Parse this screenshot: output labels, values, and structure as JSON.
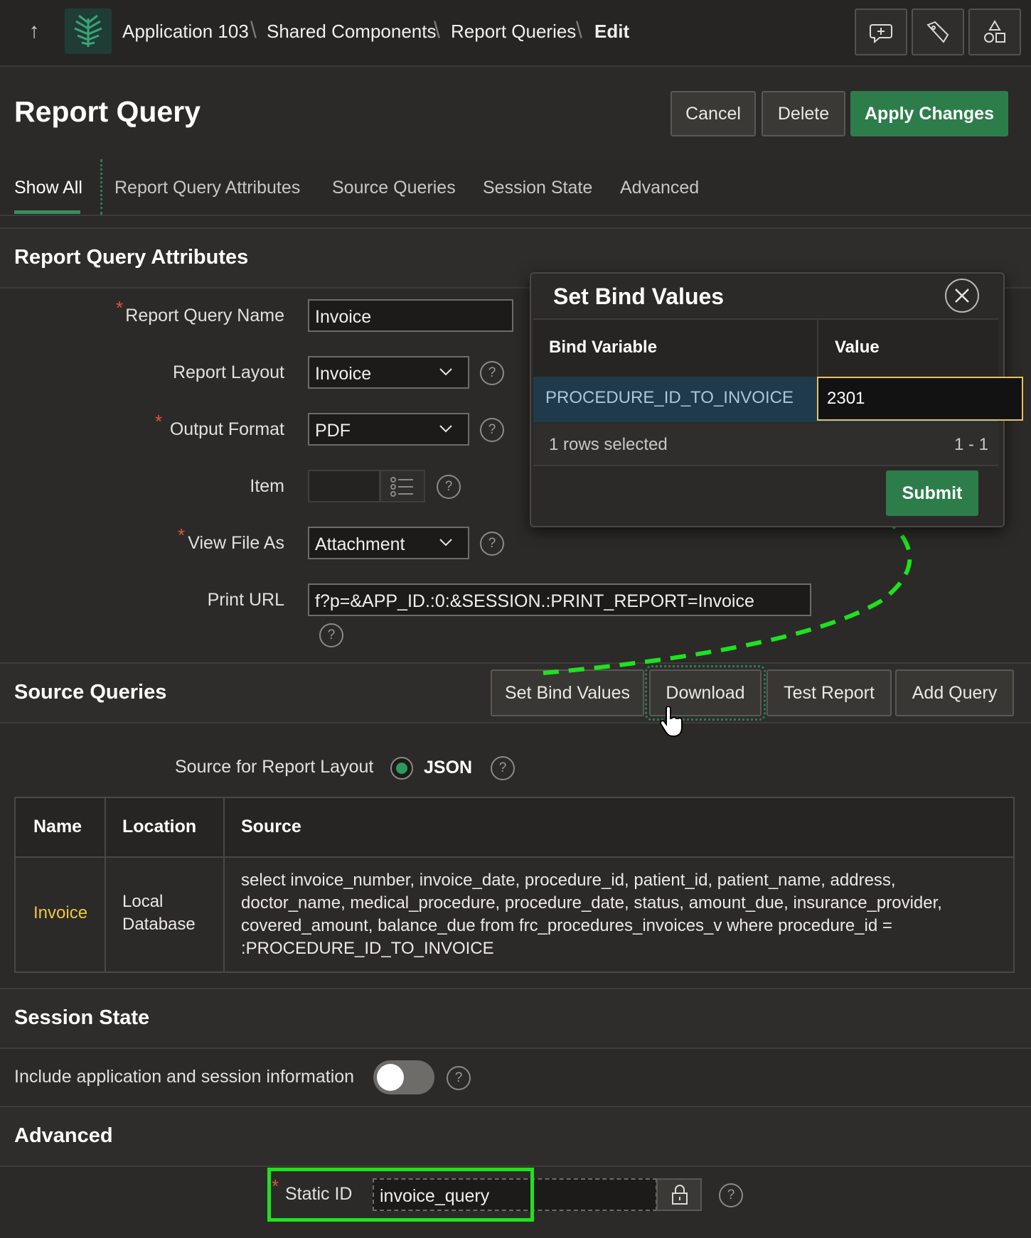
{
  "breadcrumbs": [
    "Application 103",
    "Shared Components",
    "Report Queries",
    "Edit"
  ],
  "toolbar_icons": [
    "feedback-icon",
    "developer-tools-icon",
    "shared-components-icon"
  ],
  "page_title": "Report Query",
  "header_buttons": {
    "cancel": "Cancel",
    "delete": "Delete",
    "apply": "Apply Changes"
  },
  "tabs": [
    "Show All",
    "Report Query Attributes",
    "Source Queries",
    "Session State",
    "Advanced"
  ],
  "attributes": {
    "title": "Report Query Attributes",
    "name_label": "Report Query Name",
    "name_value": "Invoice",
    "layout_label": "Report Layout",
    "layout_value": "Invoice",
    "format_label": "Output Format",
    "format_value": "PDF",
    "item_label": "Item",
    "item_value": "",
    "view_label": "View File As",
    "view_value": "Attachment",
    "print_label": "Print URL",
    "print_value": "f?p=&APP_ID.:0:&SESSION.:PRINT_REPORT=Invoice",
    "required_mark": "*",
    "help": "?"
  },
  "modal": {
    "title": "Set Bind Values",
    "col_var": "Bind Variable",
    "col_val": "Value",
    "row_var": "PROCEDURE_ID_TO_INVOICE",
    "row_val": "2301",
    "rows_selected": "1 rows selected",
    "range": "1 - 1",
    "submit": "Submit"
  },
  "source_queries": {
    "title": "Source Queries",
    "buttons": [
      "Set Bind Values",
      "Download",
      "Test Report",
      "Add Query"
    ],
    "source_label": "Source for Report Layout",
    "source_option": "JSON",
    "columns": [
      "Name",
      "Location",
      "Source"
    ],
    "row": {
      "name": "Invoice",
      "location_1": "Local",
      "location_2": "Database",
      "source_lines": [
        "select invoice_number, invoice_date, procedure_id, patient_id, patient_name, address,",
        "doctor_name, medical_procedure, procedure_date, status, amount_due, insurance_provider,",
        "covered_amount, balance_due from frc_procedures_invoices_v where procedure_id =",
        ":PROCEDURE_ID_TO_INVOICE"
      ]
    }
  },
  "session_state": {
    "title": "Session State",
    "include_label": "Include application and session information",
    "include_on": false
  },
  "advanced": {
    "title": "Advanced",
    "static_label": "Static ID",
    "static_value": "invoice_query"
  },
  "colors": {
    "accent_green": "#2d7d4b",
    "annotation_green": "#1fe21f",
    "link_yellow": "#f0c542",
    "required_red": "#e0533f"
  }
}
